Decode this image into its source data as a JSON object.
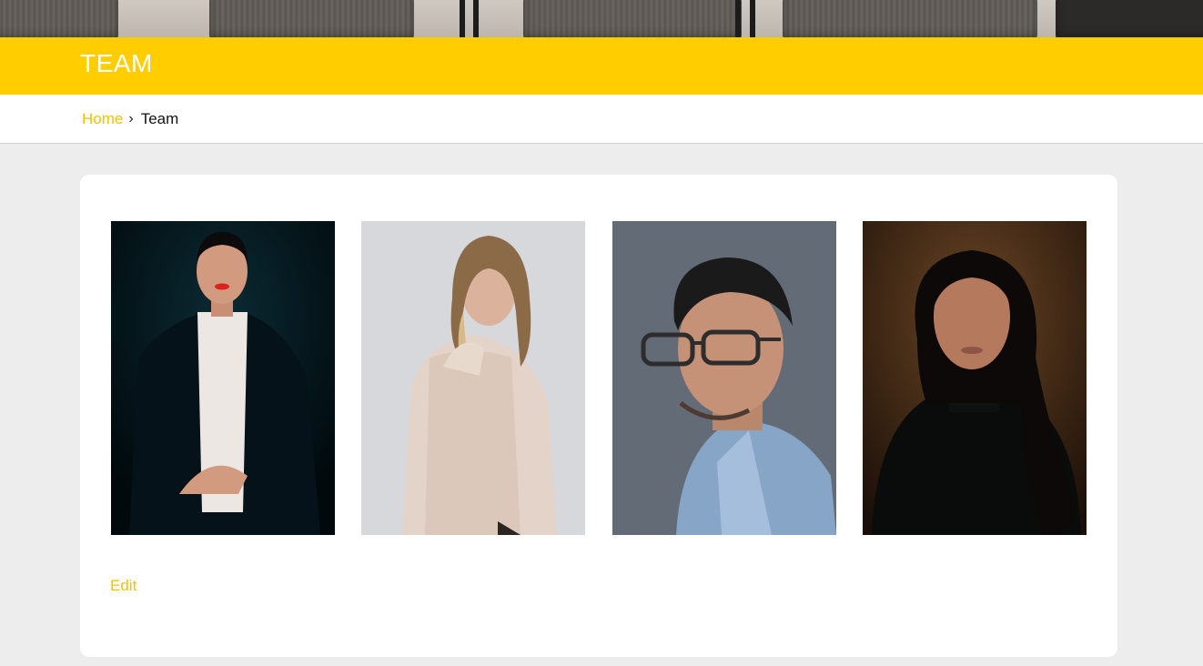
{
  "header": {
    "title": "TEAM"
  },
  "breadcrumb": {
    "home": "Home",
    "separator": "›",
    "current": "Team"
  },
  "team": {
    "members": [
      {
        "photo": "portrait-woman-dark-blazer"
      },
      {
        "photo": "portrait-woman-knit-sweater"
      },
      {
        "photo": "portrait-man-glasses-denim"
      },
      {
        "photo": "portrait-woman-black-turtleneck"
      }
    ],
    "edit_label": "Edit"
  },
  "colors": {
    "accent": "#ffcd00",
    "link": "#f2c200",
    "background": "#ededed"
  }
}
